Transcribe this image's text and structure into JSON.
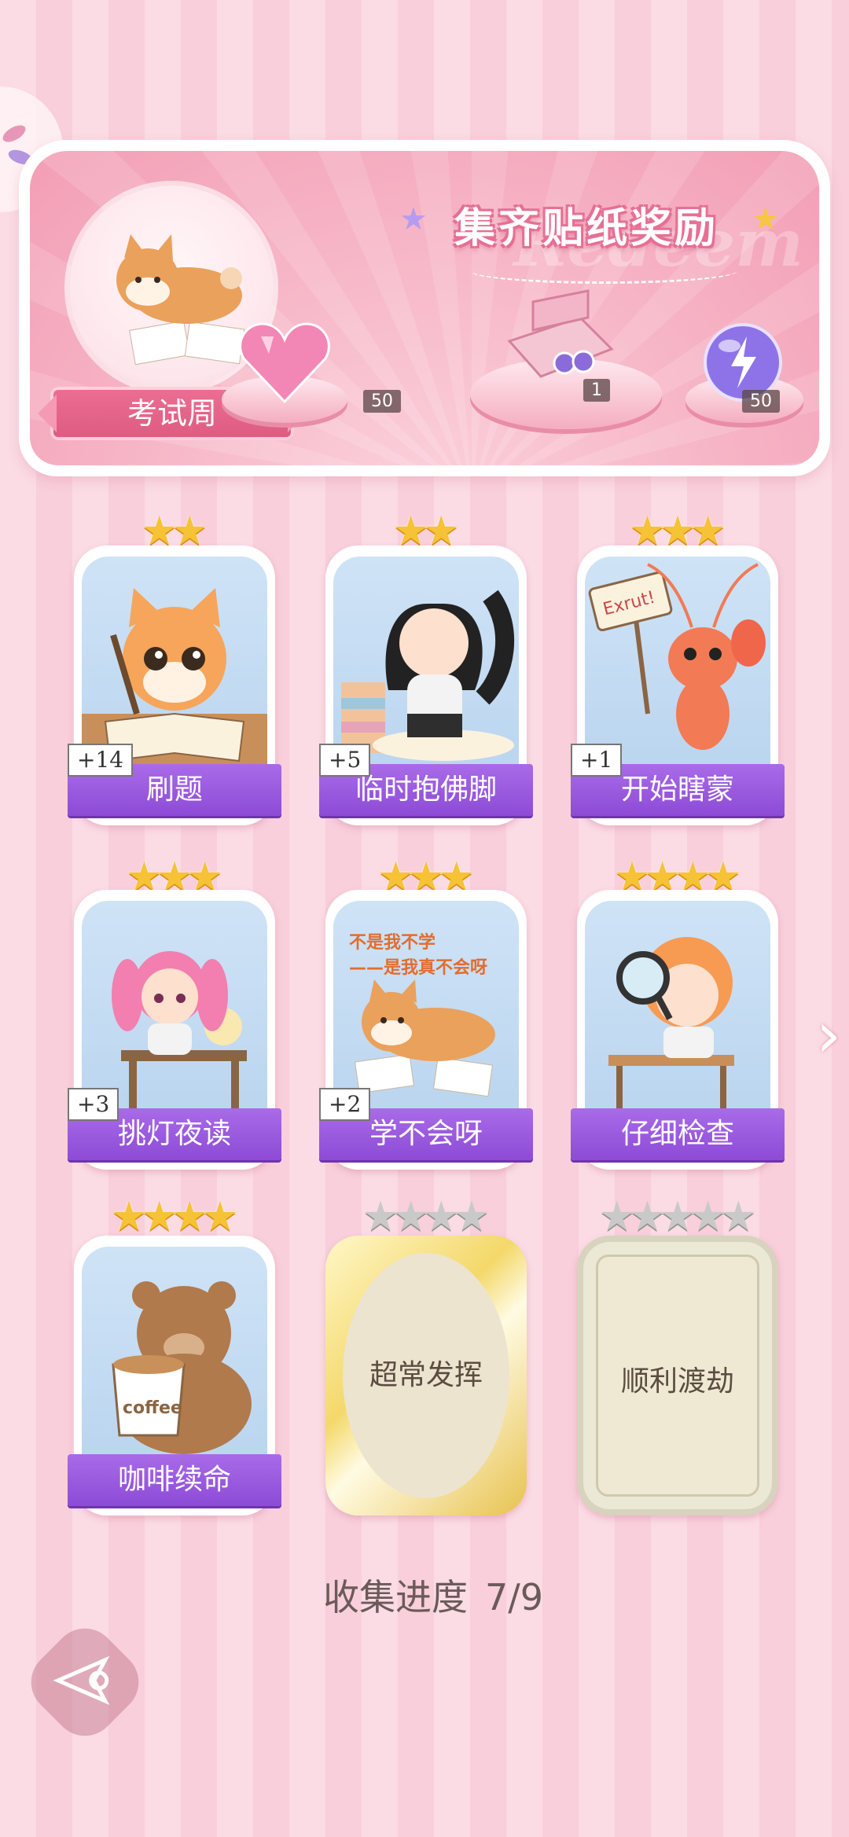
{
  "banner": {
    "title": "集齐贴纸奖励",
    "watermark": "Redeem",
    "theme_label": "考试周",
    "rewards": [
      {
        "name": "heart-gem",
        "qty": "50"
      },
      {
        "name": "gift-box",
        "qty": "1"
      },
      {
        "name": "energy-orb",
        "qty": "50"
      }
    ]
  },
  "stickers": [
    {
      "label": "刷题",
      "count": "+14",
      "stars": 2,
      "icon": "cat-studying"
    },
    {
      "label": "临时抱佛脚",
      "count": "+5",
      "stars": 2,
      "icon": "girl-praying"
    },
    {
      "label": "开始瞎蒙",
      "count": "+1",
      "stars": 3,
      "icon": "shrimp-sign"
    },
    {
      "label": "挑灯夜读",
      "count": "+3",
      "stars": 3,
      "icon": "girl-lamp"
    },
    {
      "label": "学不会呀",
      "count": "+2",
      "stars": 3,
      "icon": "dog-lying",
      "caption": "不是我不学\n——是我真不会呀"
    },
    {
      "label": "仔细检查",
      "count": "",
      "stars": 4,
      "icon": "girl-magnifier"
    },
    {
      "label": "咖啡续命",
      "count": "",
      "stars": 4,
      "icon": "bear-coffee",
      "cup_text": "coffee"
    },
    {
      "label": "超常发挥",
      "count": "",
      "stars": 4,
      "icon": "locked-gold"
    },
    {
      "label": "顺利渡劫",
      "count": "",
      "stars": 5,
      "icon": "locked-silver"
    }
  ],
  "progress": {
    "label": "收集进度",
    "value": "7/9"
  },
  "colors": {
    "accent": "#8d4bd6",
    "pink": "#ec6f93",
    "gold_star": "#f6c236"
  },
  "sign_text": "Exrut!"
}
